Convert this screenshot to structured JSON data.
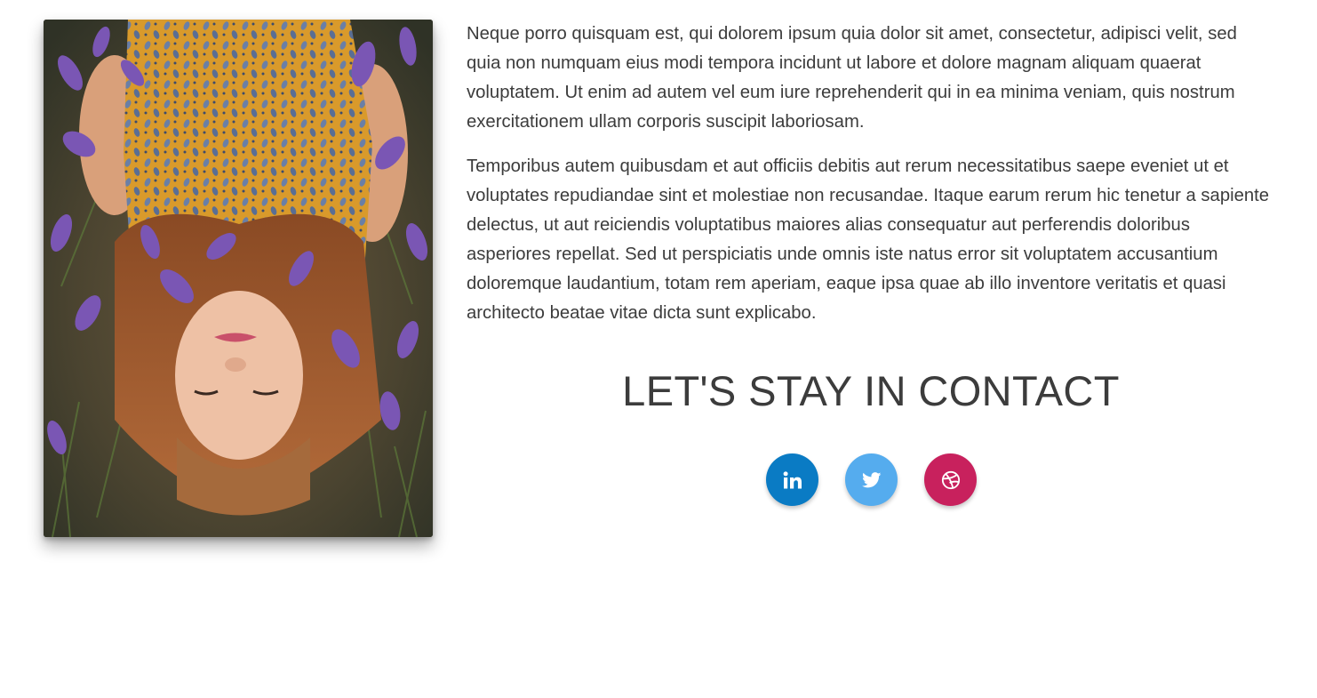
{
  "about": {
    "paragraphs": [
      "Neque porro quisquam est, qui dolorem ipsum quia dolor sit amet, consectetur, adipisci velit, sed quia non numquam eius modi tempora incidunt ut labore et dolore magnam aliquam quaerat voluptatem. Ut enim ad autem vel eum iure reprehenderit qui in ea minima veniam, quis nostrum exercitationem ullam corporis suscipit laboriosam.",
      "Temporibus autem quibusdam et aut officiis debitis aut rerum necessitatibus saepe eveniet ut et voluptates repudiandae sint et molestiae non recusandae. Itaque earum rerum hic tenetur a sapiente delectus, ut aut reiciendis voluptatibus maiores alias consequatur aut perferendis doloribus asperiores repellat. Sed ut perspiciatis unde omnis iste natus error sit voluptatem accusantium doloremque laudantium, totam rem aperiam, eaque ipsa quae ab illo inventore veritatis et quasi architecto beatae vitae dicta sunt explicabo."
    ]
  },
  "contact": {
    "heading": "LET'S STAY IN CONTACT",
    "social": [
      {
        "icon": "linkedin-icon",
        "color": "#0a7bc4"
      },
      {
        "icon": "twitter-icon",
        "color": "#55acee"
      },
      {
        "icon": "dribbble-icon",
        "color": "#c8215d"
      }
    ]
  },
  "photo": {
    "icon": "woman-in-lavender-field-photo"
  }
}
